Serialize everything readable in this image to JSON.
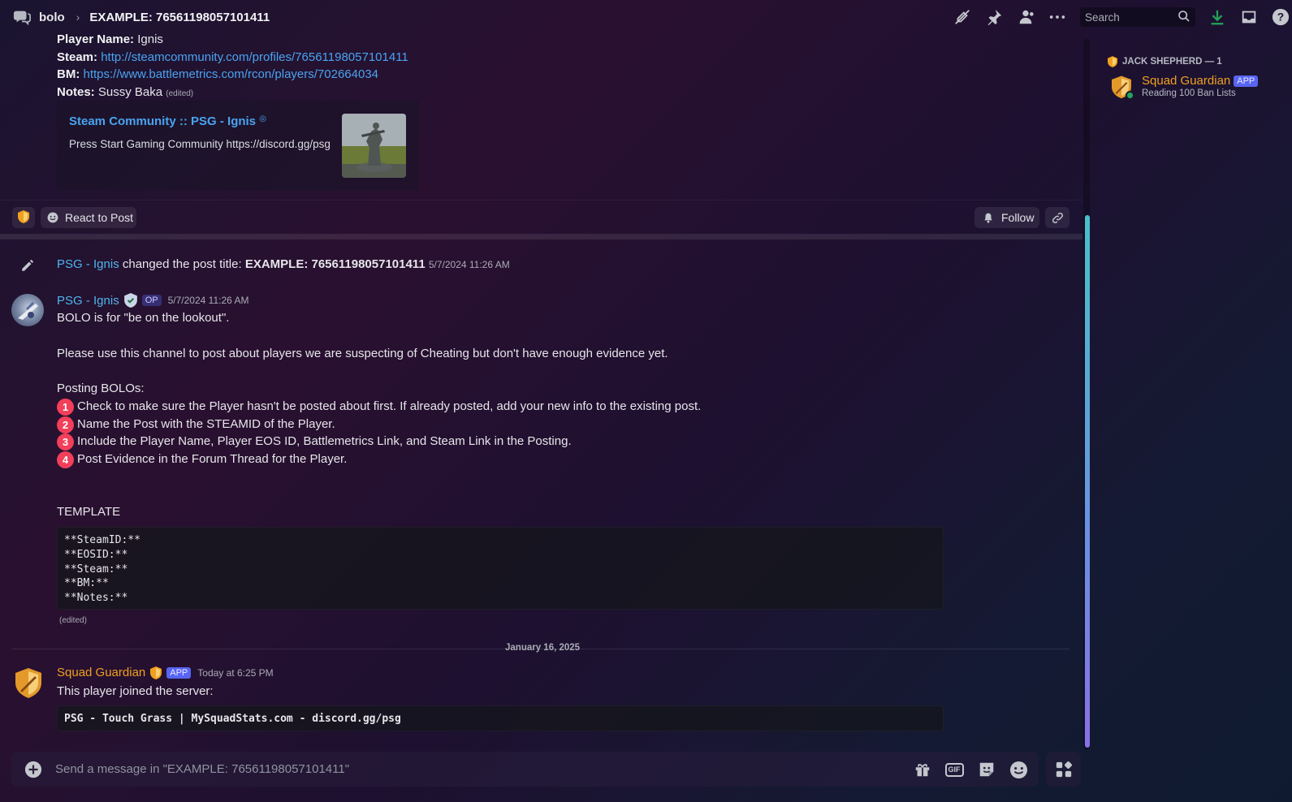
{
  "topbar": {
    "channel": "bolo",
    "thread_title": "EXAMPLE: 76561198057101411",
    "search_placeholder": "Search"
  },
  "op_post": {
    "player_name_label": "Player Name:",
    "player_name": "Ignis",
    "steam_label": "Steam:",
    "steam_url": "http://steamcommunity.com/profiles/76561198057101411",
    "bm_label": "BM:",
    "bm_url": "https://www.battlemetrics.com/rcon/players/702664034",
    "notes_label": "Notes:",
    "notes": "Sussy Baka",
    "edited": "(edited)",
    "embed": {
      "title": "Steam Community :: PSG - Ignis",
      "description": "Press Start Gaming Community https://discord.gg/psg"
    }
  },
  "reactbar": {
    "react_label": "React to Post",
    "follow_label": "Follow"
  },
  "system_message": {
    "author": "PSG - Ignis",
    "text": "changed the post title:",
    "new_title": "EXAMPLE: 76561198057101411",
    "timestamp": "5/7/2024 11:26 AM"
  },
  "message1": {
    "author": "PSG - Ignis",
    "badge": "OP",
    "timestamp": "5/7/2024 11:26 AM",
    "line1": "BOLO is for \"be on the lookout\".",
    "line2": "Please use this channel to post about players we are suspecting of Cheating but don't have enough evidence yet.",
    "line3": "Posting BOLOs:",
    "steps": [
      {
        "n": "1",
        "text": "Check to make sure the Player hasn't be posted about first. If already posted, add your new info to the existing post."
      },
      {
        "n": "2",
        "text": "Name the Post with the STEAMID of the Player."
      },
      {
        "n": "3",
        "text": "Include the Player Name, Player EOS ID, Battlemetrics Link, and Steam Link in the Posting."
      },
      {
        "n": "4",
        "text": "Post Evidence in the Forum Thread for the Player."
      }
    ],
    "template_label": "TEMPLATE",
    "code_lines": [
      "**SteamID:**",
      "**EOSID:**",
      "**Steam:**",
      "**BM:**",
      "**Notes:**"
    ],
    "edited": "(edited)"
  },
  "date_divider": "January 16, 2025",
  "message2": {
    "author": "Squad Guardian",
    "badge": "APP",
    "timestamp": "Today at 6:25 PM",
    "text": "This player joined the server:",
    "code": "PSG - Touch Grass | MySquadStats.com - discord.gg/psg"
  },
  "members": {
    "header": "JACK SHEPHERD — 1",
    "name": "Squad Guardian",
    "badge": "APP",
    "status": "Reading 100 Ban Lists"
  },
  "composer": {
    "placeholder": "Send a message in \"EXAMPLE: 76561198057101411\""
  },
  "colors": {
    "link": "#4aa3f0",
    "author_blue": "#4fb5ef",
    "author_gold": "#f0a020",
    "badge": "#5865f2",
    "step_number": "#f23f5a",
    "online": "#23a55a"
  }
}
